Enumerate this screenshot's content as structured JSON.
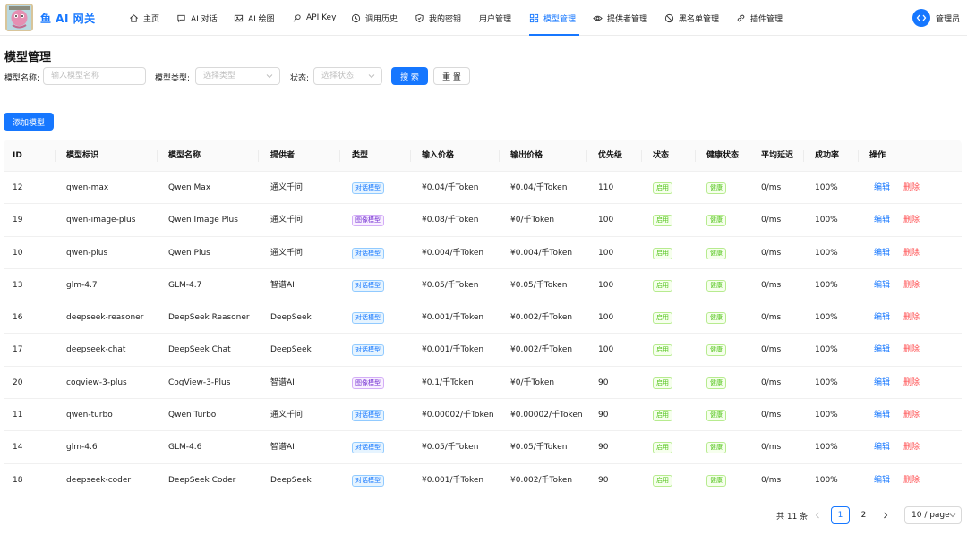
{
  "header": {
    "brand": "鱼 AI 网关",
    "user_name": "管理员",
    "nav": [
      {
        "label": "主页",
        "icon": "home-icon"
      },
      {
        "label": "AI 对话",
        "icon": "chat-icon"
      },
      {
        "label": "AI 绘图",
        "icon": "image-icon"
      },
      {
        "label": "API Key",
        "icon": "key-icon"
      },
      {
        "label": "调用历史",
        "icon": "history-icon"
      },
      {
        "label": "我的密钥",
        "icon": "shield-icon"
      },
      {
        "label": "用户管理",
        "icon": ""
      },
      {
        "label": "模型管理",
        "icon": "grid-icon",
        "active": true
      },
      {
        "label": "提供者管理",
        "icon": "eye-icon"
      },
      {
        "label": "黑名单管理",
        "icon": "block-icon"
      },
      {
        "label": "插件管理",
        "icon": "link-icon"
      }
    ]
  },
  "page": {
    "title": "模型管理"
  },
  "filters": {
    "name_label": "模型名称:",
    "name_placeholder": "输入模型名称",
    "type_label": "模型类型:",
    "type_placeholder": "选择类型",
    "status_label": "状态:",
    "status_placeholder": "选择状态",
    "search_button": "搜 索",
    "reset_button": "重 置"
  },
  "add_button": "添加模型",
  "table": {
    "columns": [
      "ID",
      "模型标识",
      "模型名称",
      "提供者",
      "类型",
      "输入价格",
      "输出价格",
      "优先级",
      "状态",
      "健康状态",
      "平均延迟",
      "成功率",
      "操作"
    ],
    "rows": [
      {
        "id": "12",
        "key": "qwen-max",
        "name": "Qwen Max",
        "provider": "通义千问",
        "type": "对话模型",
        "in_price": "¥0.04/千Token",
        "out_price": "¥0.04/千Token",
        "priority": "110",
        "status": "启用",
        "health": "健康",
        "latency": "0/ms",
        "success": "100%"
      },
      {
        "id": "19",
        "key": "qwen-image-plus",
        "name": "Qwen Image Plus",
        "provider": "通义千问",
        "type": "图像模型",
        "in_price": "¥0.08/千Token",
        "out_price": "¥0/千Token",
        "priority": "100",
        "status": "启用",
        "health": "健康",
        "latency": "0/ms",
        "success": "100%"
      },
      {
        "id": "10",
        "key": "qwen-plus",
        "name": "Qwen Plus",
        "provider": "通义千问",
        "type": "对话模型",
        "in_price": "¥0.004/千Token",
        "out_price": "¥0.004/千Token",
        "priority": "100",
        "status": "启用",
        "health": "健康",
        "latency": "0/ms",
        "success": "100%"
      },
      {
        "id": "13",
        "key": "glm-4.7",
        "name": "GLM-4.7",
        "provider": "智谱AI",
        "type": "对话模型",
        "in_price": "¥0.05/千Token",
        "out_price": "¥0.05/千Token",
        "priority": "100",
        "status": "启用",
        "health": "健康",
        "latency": "0/ms",
        "success": "100%"
      },
      {
        "id": "16",
        "key": "deepseek-reasoner",
        "name": "DeepSeek Reasoner",
        "provider": "DeepSeek",
        "type": "对话模型",
        "in_price": "¥0.001/千Token",
        "out_price": "¥0.002/千Token",
        "priority": "100",
        "status": "启用",
        "health": "健康",
        "latency": "0/ms",
        "success": "100%"
      },
      {
        "id": "17",
        "key": "deepseek-chat",
        "name": "DeepSeek Chat",
        "provider": "DeepSeek",
        "type": "对话模型",
        "in_price": "¥0.001/千Token",
        "out_price": "¥0.002/千Token",
        "priority": "100",
        "status": "启用",
        "health": "健康",
        "latency": "0/ms",
        "success": "100%"
      },
      {
        "id": "20",
        "key": "cogview-3-plus",
        "name": "CogView-3-Plus",
        "provider": "智谱AI",
        "type": "图像模型",
        "in_price": "¥0.1/千Token",
        "out_price": "¥0/千Token",
        "priority": "90",
        "status": "启用",
        "health": "健康",
        "latency": "0/ms",
        "success": "100%"
      },
      {
        "id": "11",
        "key": "qwen-turbo",
        "name": "Qwen Turbo",
        "provider": "通义千问",
        "type": "对话模型",
        "in_price": "¥0.00002/千Token",
        "out_price": "¥0.00002/千Token",
        "priority": "90",
        "status": "启用",
        "health": "健康",
        "latency": "0/ms",
        "success": "100%"
      },
      {
        "id": "14",
        "key": "glm-4.6",
        "name": "GLM-4.6",
        "provider": "智谱AI",
        "type": "对话模型",
        "in_price": "¥0.05/千Token",
        "out_price": "¥0.05/千Token",
        "priority": "90",
        "status": "启用",
        "health": "健康",
        "latency": "0/ms",
        "success": "100%"
      },
      {
        "id": "18",
        "key": "deepseek-coder",
        "name": "DeepSeek Coder",
        "provider": "DeepSeek",
        "type": "对话模型",
        "in_price": "¥0.001/千Token",
        "out_price": "¥0.002/千Token",
        "priority": "90",
        "status": "启用",
        "health": "健康",
        "latency": "0/ms",
        "success": "100%"
      }
    ],
    "actions": {
      "edit": "编辑",
      "delete": "删除"
    }
  },
  "pagination": {
    "total": "共 11 条",
    "pages": [
      "1",
      "2"
    ],
    "current": "1",
    "page_size": "10 / page"
  },
  "colors": {
    "primary": "#1677ff",
    "danger": "#ff4d4f",
    "success": "#52c41a",
    "purple": "#722ed1"
  }
}
